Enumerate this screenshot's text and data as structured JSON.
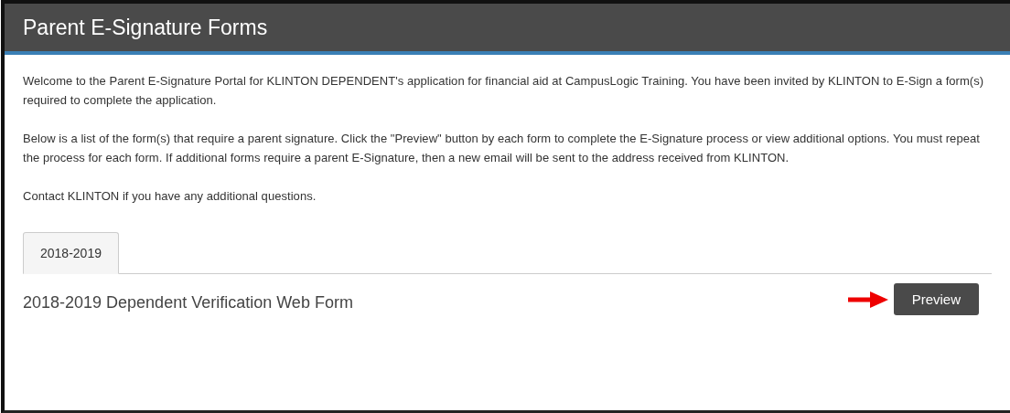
{
  "header": {
    "title": "Parent E-Signature Forms"
  },
  "paragraphs": [
    "Welcome to the Parent E-Signature Portal for KLINTON DEPENDENT's application for financial aid at CampusLogic Training. You have been invited by KLINTON to E-Sign a form(s) required to complete the application.",
    "Below is a list of the form(s) that require a parent signature. Click the \"Preview\" button by each form to complete the E-Signature process or view additional options. You must repeat the process for each form. If additional forms require a parent E-Signature, then a new email will be sent to the address received from KLINTON.",
    "Contact KLINTON if you have any additional questions."
  ],
  "tabs": [
    {
      "label": "2018-2019",
      "selected": true
    }
  ],
  "forms": [
    {
      "name": "2018-2019 Dependent Verification Web Form",
      "button": "Preview"
    }
  ]
}
